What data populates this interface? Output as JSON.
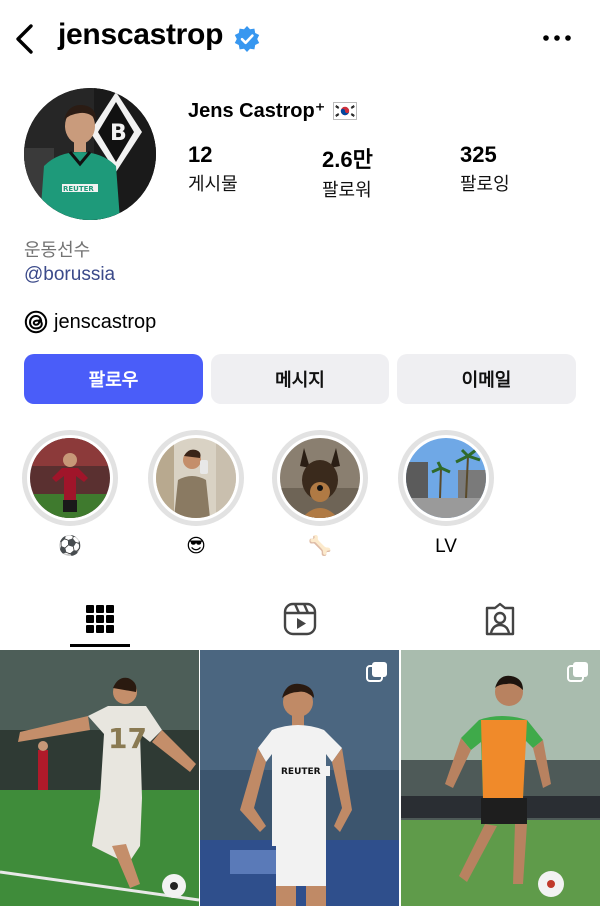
{
  "header": {
    "username": "jenscastrop",
    "verified_icon": "verified-badge-icon",
    "back_icon": "chevron-left-icon",
    "more_icon": "more-dots-icon"
  },
  "profile": {
    "display_name": "Jens Castrop⁺",
    "flag_icon": "south-korea-flag-icon",
    "stats": [
      {
        "value": "12",
        "label": "게시물"
      },
      {
        "value": "2.6만",
        "label": "팔로워"
      },
      {
        "value": "325",
        "label": "팔로잉"
      }
    ],
    "category": "운동선수",
    "link": "@borussia",
    "threads_handle": "jenscastrop"
  },
  "actions": {
    "follow": "팔로우",
    "message": "메시지",
    "email": "이메일"
  },
  "highlights": [
    {
      "label": "⚽",
      "image": "player-celebrating"
    },
    {
      "label": "😎",
      "image": "mirror-selfie"
    },
    {
      "label": "🦴",
      "image": "german-shepherd-dog"
    },
    {
      "label": "LV",
      "image": "palm-street"
    }
  ],
  "tabs": [
    {
      "name": "grid-icon",
      "active": true
    },
    {
      "name": "reels-icon",
      "active": false
    },
    {
      "name": "tagged-icon",
      "active": false
    }
  ],
  "posts": [
    {
      "subject": "free-kick-stadium",
      "multi": false
    },
    {
      "subject": "white-kit-portrait",
      "multi": true
    },
    {
      "subject": "training-orange-bib",
      "multi": true
    }
  ],
  "colors": {
    "accent": "#4a5df9",
    "verified": "#3797f0",
    "link": "#3b4a8a",
    "secondary_button": "#efeff2"
  }
}
